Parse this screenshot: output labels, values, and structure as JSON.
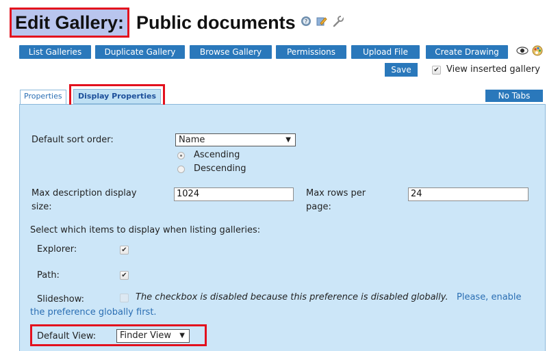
{
  "heading": {
    "prefix": "Edit Gallery:",
    "name": "Public documents",
    "icons": [
      "help-icon",
      "edit-icon",
      "wrench-icon"
    ]
  },
  "toolbar": {
    "buttons": [
      "List Galleries",
      "Duplicate Gallery",
      "Browse Gallery",
      "Permissions",
      "Upload File",
      "Create Drawing"
    ],
    "save_label": "Save",
    "view_inserted_label": "View inserted gallery",
    "view_inserted_checked": true,
    "extra_icons": [
      "eye-icon",
      "palette-icon"
    ]
  },
  "tabs": {
    "items": [
      "Properties",
      "Display Properties"
    ],
    "active": "Display Properties",
    "no_tabs_label": "No Tabs"
  },
  "form": {
    "sort_order_label": "Default sort order:",
    "sort_order_value": "Name",
    "ascending_label": "Ascending",
    "descending_label": "Descending",
    "ascending_selected": true,
    "max_desc_label": "Max description display size:",
    "max_desc_label_1": "Max description display",
    "max_desc_label_2": "size:",
    "max_desc_value": "1024",
    "max_rows_label_1": "Max rows per",
    "max_rows_label_2": "page:",
    "max_rows_value": "24",
    "select_items_label": "Select which items to display when listing galleries:",
    "explorer_label": "Explorer:",
    "explorer_checked": true,
    "path_label": "Path:",
    "path_checked": true,
    "slideshow_label": "Slideshow:",
    "slideshow_checked": false,
    "slideshow_note": "The checkbox is disabled because this preference is disabled globally.",
    "slideshow_link_1": "Please, enable",
    "slideshow_link_2": "the preference globally first.",
    "default_view_label": "Default View:",
    "default_view_value": "Finder View"
  },
  "colors": {
    "button_blue": "#2a78bb",
    "panel_bg": "#cce6f8",
    "highlight_red": "#e3101d",
    "title_bg": "#b9c5ee"
  }
}
